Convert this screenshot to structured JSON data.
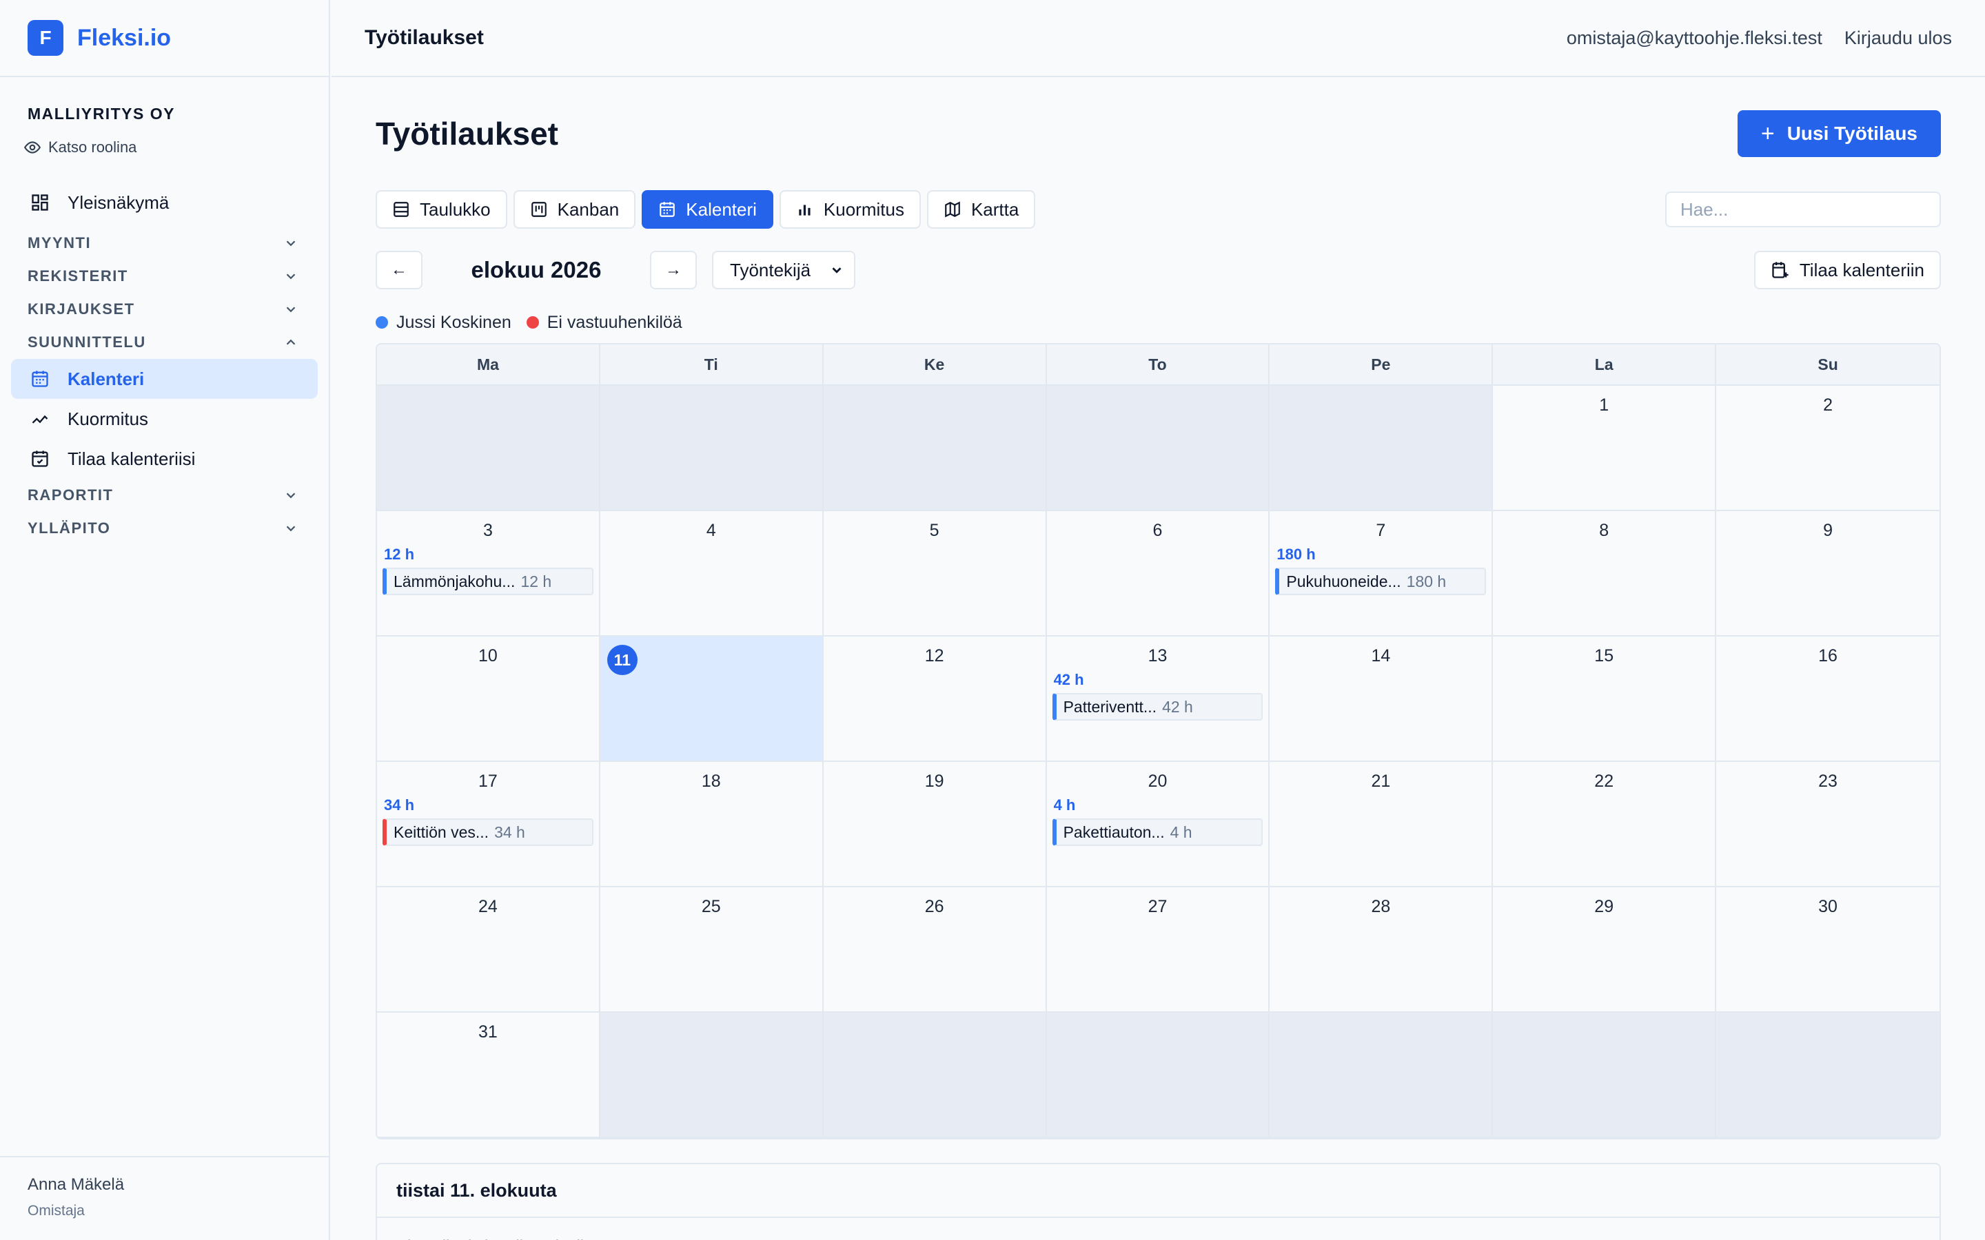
{
  "brand": {
    "logo_letter": "F",
    "name": "Fleksi.io",
    "color": "#2563eb"
  },
  "sidebar": {
    "company": "MALLIYRITYS OY",
    "view_as_role": "Katso roolina",
    "overview": "Yleisnäkymä",
    "sections": {
      "sales": "MYYNTI",
      "registers": "REKISTERIT",
      "bookkeeping": "KIRJAUKSET",
      "planning": "SUUNNITTELU",
      "reports": "RAPORTIT",
      "admin": "YLLÄPITO"
    },
    "planning_items": [
      "Kalenteri",
      "Kuormitus",
      "Tilaa kalenteriisi"
    ],
    "user": {
      "name": "Anna Mäkelä",
      "role": "Omistaja"
    }
  },
  "topbar": {
    "title": "Työtilaukset",
    "email": "omistaja@kayttoohje.fleksi.test",
    "logout": "Kirjaudu ulos"
  },
  "page": {
    "title": "Työtilaukset",
    "new_button": "Uusi Työtilaus",
    "views": [
      "Taulukko",
      "Kanban",
      "Kalenteri",
      "Kuormitus",
      "Kartta"
    ],
    "active_view": "Kalenteri",
    "search_placeholder": "Hae..."
  },
  "calendar": {
    "prev": "←",
    "next": "→",
    "month": "elokuu 2026",
    "group_by": "Työntekijä",
    "subscribe": "Tilaa kalenteriin",
    "legend": [
      {
        "name": "Jussi Koskinen",
        "color": "#3b82f6"
      },
      {
        "name": "Ei vastuuhenkilöä",
        "color": "#ef4444"
      }
    ],
    "weekdays": [
      "Ma",
      "Ti",
      "Ke",
      "To",
      "Pe",
      "La",
      "Su"
    ],
    "leading_empty": 5,
    "days_in_month": 31,
    "today": 11,
    "events": {
      "3": {
        "total": "12 h",
        "title": "Lämmönjakohu...",
        "hours": "12 h",
        "color": "blue"
      },
      "7": {
        "total": "180 h",
        "title": "Pukuhuoneide...",
        "hours": "180 h",
        "color": "blue"
      },
      "13": {
        "total": "42 h",
        "title": "Patteriventt...",
        "hours": "42 h",
        "color": "blue"
      },
      "17": {
        "total": "34 h",
        "title": "Keittiön ves...",
        "hours": "34 h",
        "color": "red"
      },
      "20": {
        "total": "4 h",
        "title": "Pakettiauton...",
        "hours": "4 h",
        "color": "blue"
      }
    }
  },
  "day_panel": {
    "title": "tiistai 11. elokuuta",
    "empty_text": "Ei työtilauksia tälle päivälle"
  }
}
